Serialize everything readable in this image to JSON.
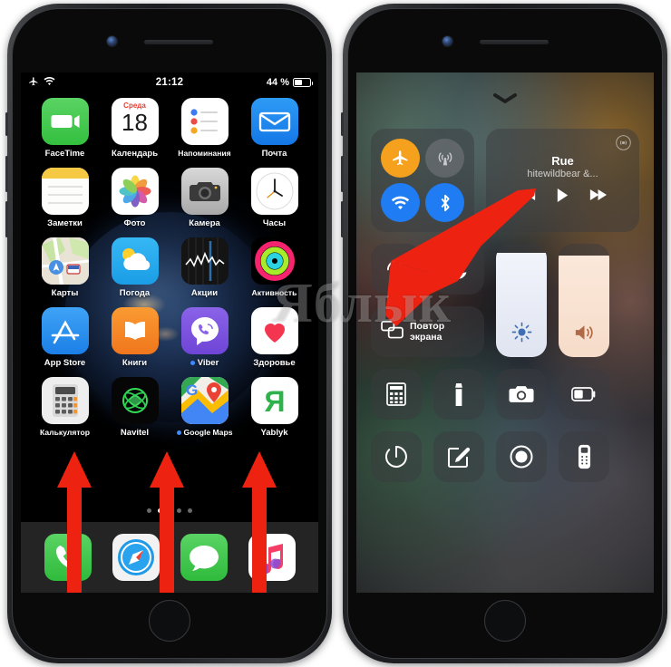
{
  "watermark": {
    "text": "Яблык"
  },
  "left_phone": {
    "device_name": "iphone-home-screen",
    "status_bar": {
      "airplane_icon": "airplane-icon",
      "wifi_icon": "wifi-icon",
      "time": "21:12",
      "battery_percent": "44 %",
      "battery_level": 44
    },
    "app_rows": [
      [
        {
          "label": "FaceTime",
          "icon": "facetime-icon",
          "badge_dot": false
        },
        {
          "label": "Календарь",
          "icon": "calendar-icon",
          "badge_dot": false,
          "cal_weekday": "Среда",
          "cal_day": "18"
        },
        {
          "label": "Напоминания",
          "icon": "reminders-icon",
          "badge_dot": false
        },
        {
          "label": "Почта",
          "icon": "mail-icon",
          "badge_dot": false
        }
      ],
      [
        {
          "label": "Заметки",
          "icon": "notes-icon",
          "badge_dot": false
        },
        {
          "label": "Фото",
          "icon": "photos-icon",
          "badge_dot": false
        },
        {
          "label": "Камера",
          "icon": "camera-icon",
          "badge_dot": false
        },
        {
          "label": "Часы",
          "icon": "clock-icon",
          "badge_dot": false
        }
      ],
      [
        {
          "label": "Карты",
          "icon": "maps-icon",
          "badge_dot": false
        },
        {
          "label": "Погода",
          "icon": "weather-icon",
          "badge_dot": false
        },
        {
          "label": "Акции",
          "icon": "stocks-icon",
          "badge_dot": false
        },
        {
          "label": "Активность",
          "icon": "activity-icon",
          "badge_dot": false
        }
      ],
      [
        {
          "label": "App Store",
          "icon": "appstore-icon",
          "badge_dot": false
        },
        {
          "label": "Книги",
          "icon": "books-icon",
          "badge_dot": false
        },
        {
          "label": "Viber",
          "icon": "viber-icon",
          "badge_dot": true
        },
        {
          "label": "Здоровье",
          "icon": "health-icon",
          "badge_dot": false
        }
      ],
      [
        {
          "label": "Калькулятор",
          "icon": "calculator-icon",
          "badge_dot": false
        },
        {
          "label": "Navitel",
          "icon": "navitel-icon",
          "badge_dot": false
        },
        {
          "label": "Google Maps",
          "icon": "googlemaps-icon",
          "badge_dot": true
        },
        {
          "label": "Yablyk",
          "icon": "yablyk-icon",
          "badge_dot": false
        }
      ]
    ],
    "page_dots": {
      "count": 4,
      "active_index": 1
    },
    "dock": [
      {
        "label": "Телефон",
        "icon": "phone-icon"
      },
      {
        "label": "Safari",
        "icon": "safari-icon"
      },
      {
        "label": "Сообщения",
        "icon": "messages-icon"
      },
      {
        "label": "Музыка",
        "icon": "music-icon"
      }
    ]
  },
  "right_phone": {
    "device_name": "iphone-control-center",
    "handle_icon": "chevron-down-icon",
    "connectivity": [
      {
        "name": "airplane-mode-toggle",
        "icon": "airplane-icon",
        "state": "on",
        "color": "#f5a11e"
      },
      {
        "name": "cellular-data-toggle",
        "icon": "cellular-icon",
        "state": "off",
        "color": "#7a7c80"
      },
      {
        "name": "wifi-toggle",
        "icon": "wifi-icon",
        "state": "on",
        "color": "#1f7cf2"
      },
      {
        "name": "bluetooth-toggle",
        "icon": "bluetooth-icon",
        "state": "on",
        "color": "#1f7cf2"
      }
    ],
    "music": {
      "airplay_icon": "airplay-icon",
      "title": "Rue",
      "artist": "hitewildbear &...",
      "prev_icon": "rewind-icon",
      "play_icon": "play-icon",
      "next_icon": "forward-icon"
    },
    "toggles": [
      {
        "name": "rotation-lock-button",
        "icon": "rotation-lock-icon",
        "label": ""
      },
      {
        "name": "do-not-disturb-button",
        "icon": "moon-icon",
        "label": ""
      }
    ],
    "screen_mirroring": {
      "name": "screen-mirroring-button",
      "icon": "screen-mirroring-icon",
      "label_line1": "Повтор",
      "label_line2": "экрана"
    },
    "brightness": {
      "name": "brightness-slider",
      "icon": "sun-icon",
      "level": 92
    },
    "volume": {
      "name": "volume-slider",
      "icon": "speaker-icon",
      "level": 90
    },
    "shortcuts_row1": [
      {
        "name": "calculator-button",
        "icon": "calculator-icon"
      },
      {
        "name": "flashlight-button",
        "icon": "flashlight-icon"
      },
      {
        "name": "camera-button",
        "icon": "camera-icon"
      },
      {
        "name": "low-power-button",
        "icon": "battery-icon"
      }
    ],
    "shortcuts_row2": [
      {
        "name": "timer-button",
        "icon": "timer-icon"
      },
      {
        "name": "notes-button",
        "icon": "note-edit-icon"
      },
      {
        "name": "screen-record-button",
        "icon": "screen-record-icon"
      },
      {
        "name": "apple-tv-remote-button",
        "icon": "remote-icon"
      }
    ]
  },
  "annotations": {
    "pointer_arrow": {
      "name": "pointer-arrow",
      "color": "#ee2211",
      "target": "rotation-lock-button"
    },
    "swipe_arrows": {
      "name": "swipe-up-arrow",
      "color": "#ee2211",
      "count": 3
    }
  }
}
